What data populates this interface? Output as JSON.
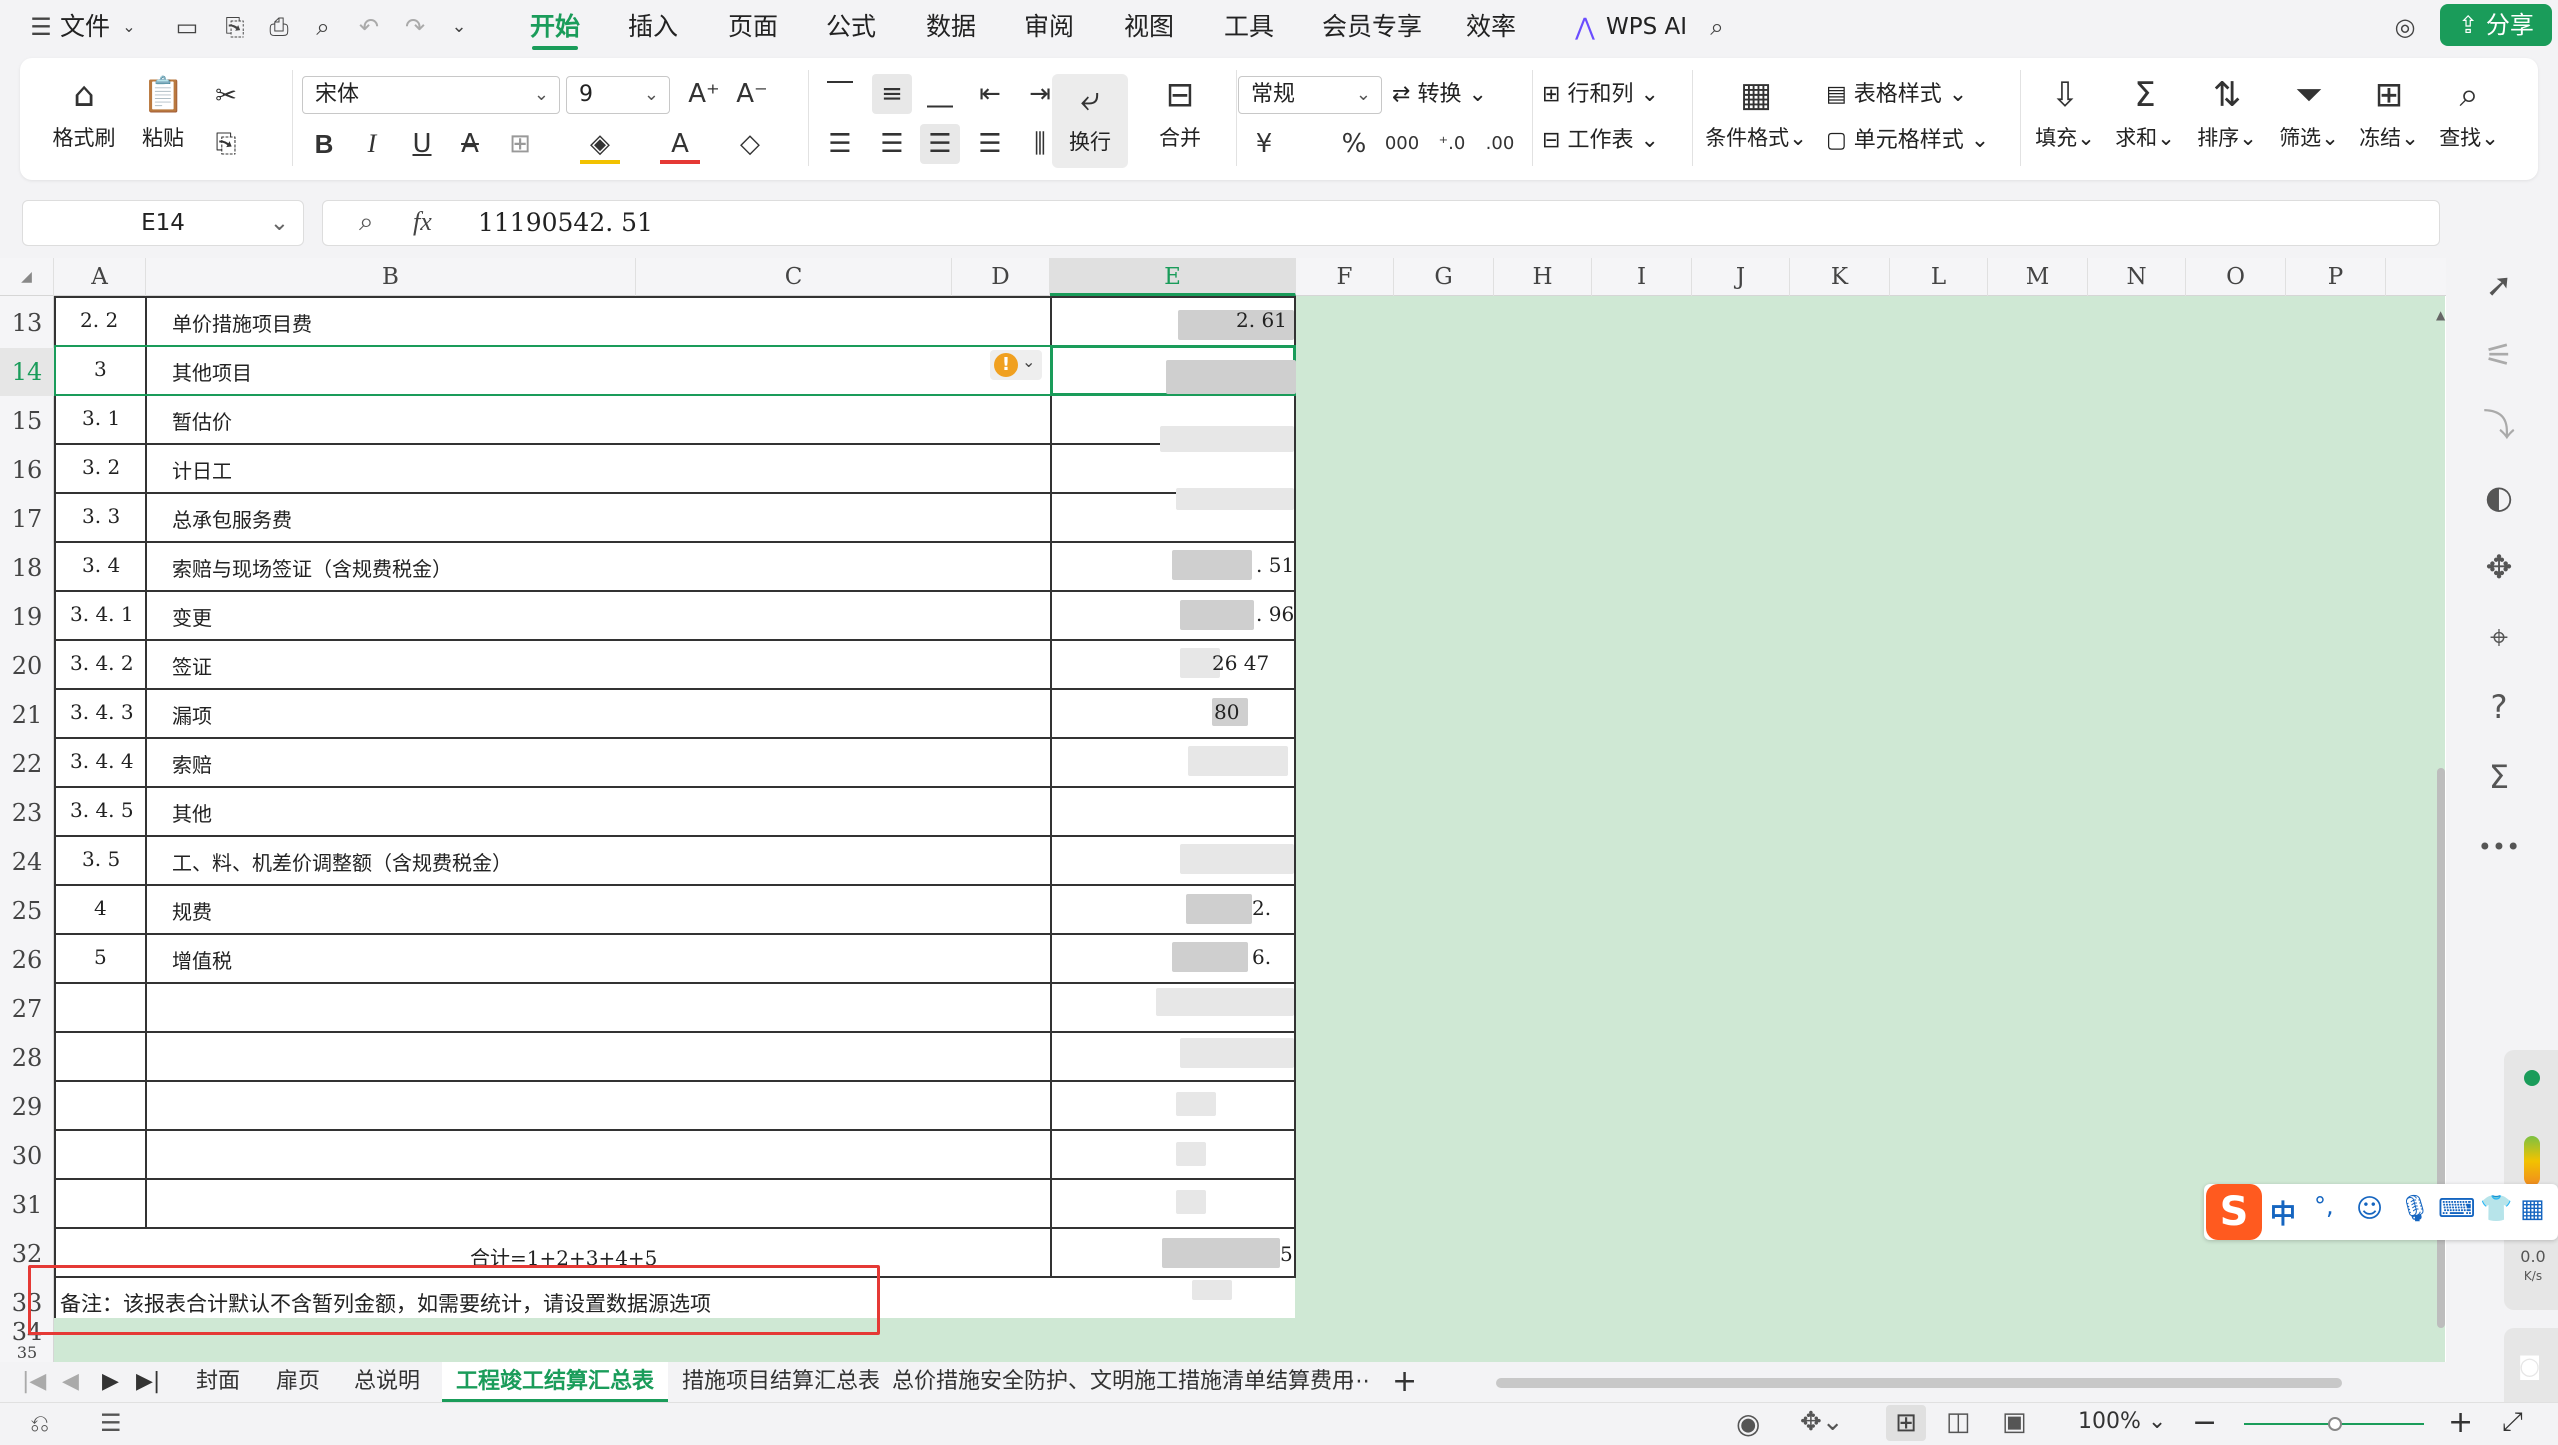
{
  "menubar": {
    "file_label": "文件",
    "tabs": [
      "开始",
      "插入",
      "页面",
      "公式",
      "数据",
      "审阅",
      "视图",
      "工具",
      "会员专享",
      "效率"
    ],
    "active_tab": "开始",
    "wps_ai_label": "WPS AI",
    "share_label": "分享"
  },
  "ribbon": {
    "format_painter": "格式刷",
    "paste": "粘贴",
    "font_name": "宋体",
    "font_size": "9",
    "wrap": "换行",
    "merge": "合并",
    "number_format": "常规",
    "convert": "转换",
    "rows_cols": "行和列",
    "worksheet": "工作表",
    "cond_format": "条件格式",
    "table_style": "表格样式",
    "cell_style": "单元格样式",
    "fill": "填充",
    "sum": "求和",
    "sort": "排序",
    "filter": "筛选",
    "freeze": "冻结",
    "find": "查找"
  },
  "formula_bar": {
    "cell_ref": "E14",
    "fx": "fx",
    "value": "11190542. 51"
  },
  "columns": [
    "A",
    "B",
    "C",
    "D",
    "E",
    "F",
    "G",
    "H",
    "I",
    "J",
    "K",
    "L",
    "M",
    "N",
    "O",
    "P"
  ],
  "rows": [
    {
      "num": "13",
      "a": "2. 2",
      "b": "单价措施项目费",
      "e": "2. 61"
    },
    {
      "num": "14",
      "a": "3",
      "b": "其他项目",
      "e": ""
    },
    {
      "num": "15",
      "a": "3. 1",
      "b": "暂估价",
      "e": ""
    },
    {
      "num": "16",
      "a": "3. 2",
      "b": "计日工",
      "e": ""
    },
    {
      "num": "17",
      "a": "3. 3",
      "b": "总承包服务费",
      "e": ""
    },
    {
      "num": "18",
      "a": "3. 4",
      "b": "索赔与现场签证（含规费税金）",
      "e": ". 51"
    },
    {
      "num": "19",
      "a": "3. 4. 1",
      "b": "变更",
      "e": ". 96"
    },
    {
      "num": "20",
      "a": "3. 4. 2",
      "b": "签证",
      "e": "26  47"
    },
    {
      "num": "21",
      "a": "3. 4. 3",
      "b": "漏项",
      "e": "80"
    },
    {
      "num": "22",
      "a": "3. 4. 4",
      "b": "索赔",
      "e": ""
    },
    {
      "num": "23",
      "a": "3. 4. 5",
      "b": "其他",
      "e": ""
    },
    {
      "num": "24",
      "a": "3. 5",
      "b": "工、料、机差价调整额（含规费税金）",
      "e": ""
    },
    {
      "num": "25",
      "a": "4",
      "b": "规费",
      "e": "2."
    },
    {
      "num": "26",
      "a": "5",
      "b": "增值税",
      "e": "6."
    },
    {
      "num": "27",
      "a": "",
      "b": "",
      "e": ""
    },
    {
      "num": "28",
      "a": "",
      "b": "",
      "e": ""
    },
    {
      "num": "29",
      "a": "",
      "b": "",
      "e": ""
    },
    {
      "num": "30",
      "a": "",
      "b": "",
      "e": ""
    },
    {
      "num": "31",
      "a": "",
      "b": "",
      "e": ""
    },
    {
      "num": "32",
      "a": "",
      "b": "",
      "e": "5"
    },
    {
      "num": "33",
      "a": "",
      "b": "",
      "e": ""
    },
    {
      "num": "34",
      "a": "",
      "b": "",
      "e": ""
    },
    {
      "num": "35",
      "a": "",
      "b": "",
      "e": ""
    }
  ],
  "total_row_label": "合计=1+2+3+4+5",
  "remark": "备注：该报表合计默认不含暂列金额，如需要统计，请设置数据源选项",
  "sheets": [
    "封面",
    "扉页",
    "总说明",
    "工程竣工结算汇总表",
    "措施项目结算汇总表",
    "总价措施安全防护、文明施工措施清单结算费用"
  ],
  "active_sheet": "工程竣工结算汇总表",
  "status": {
    "zoom": "100%"
  },
  "ime": {
    "lang": "中",
    "punct": "°,",
    "speed": "0.0",
    "speed_unit": "K/s"
  },
  "colors": {
    "accent": "#1a9c5a",
    "sheet_bg": "#cfe8d4",
    "annotation": "#e53935"
  }
}
